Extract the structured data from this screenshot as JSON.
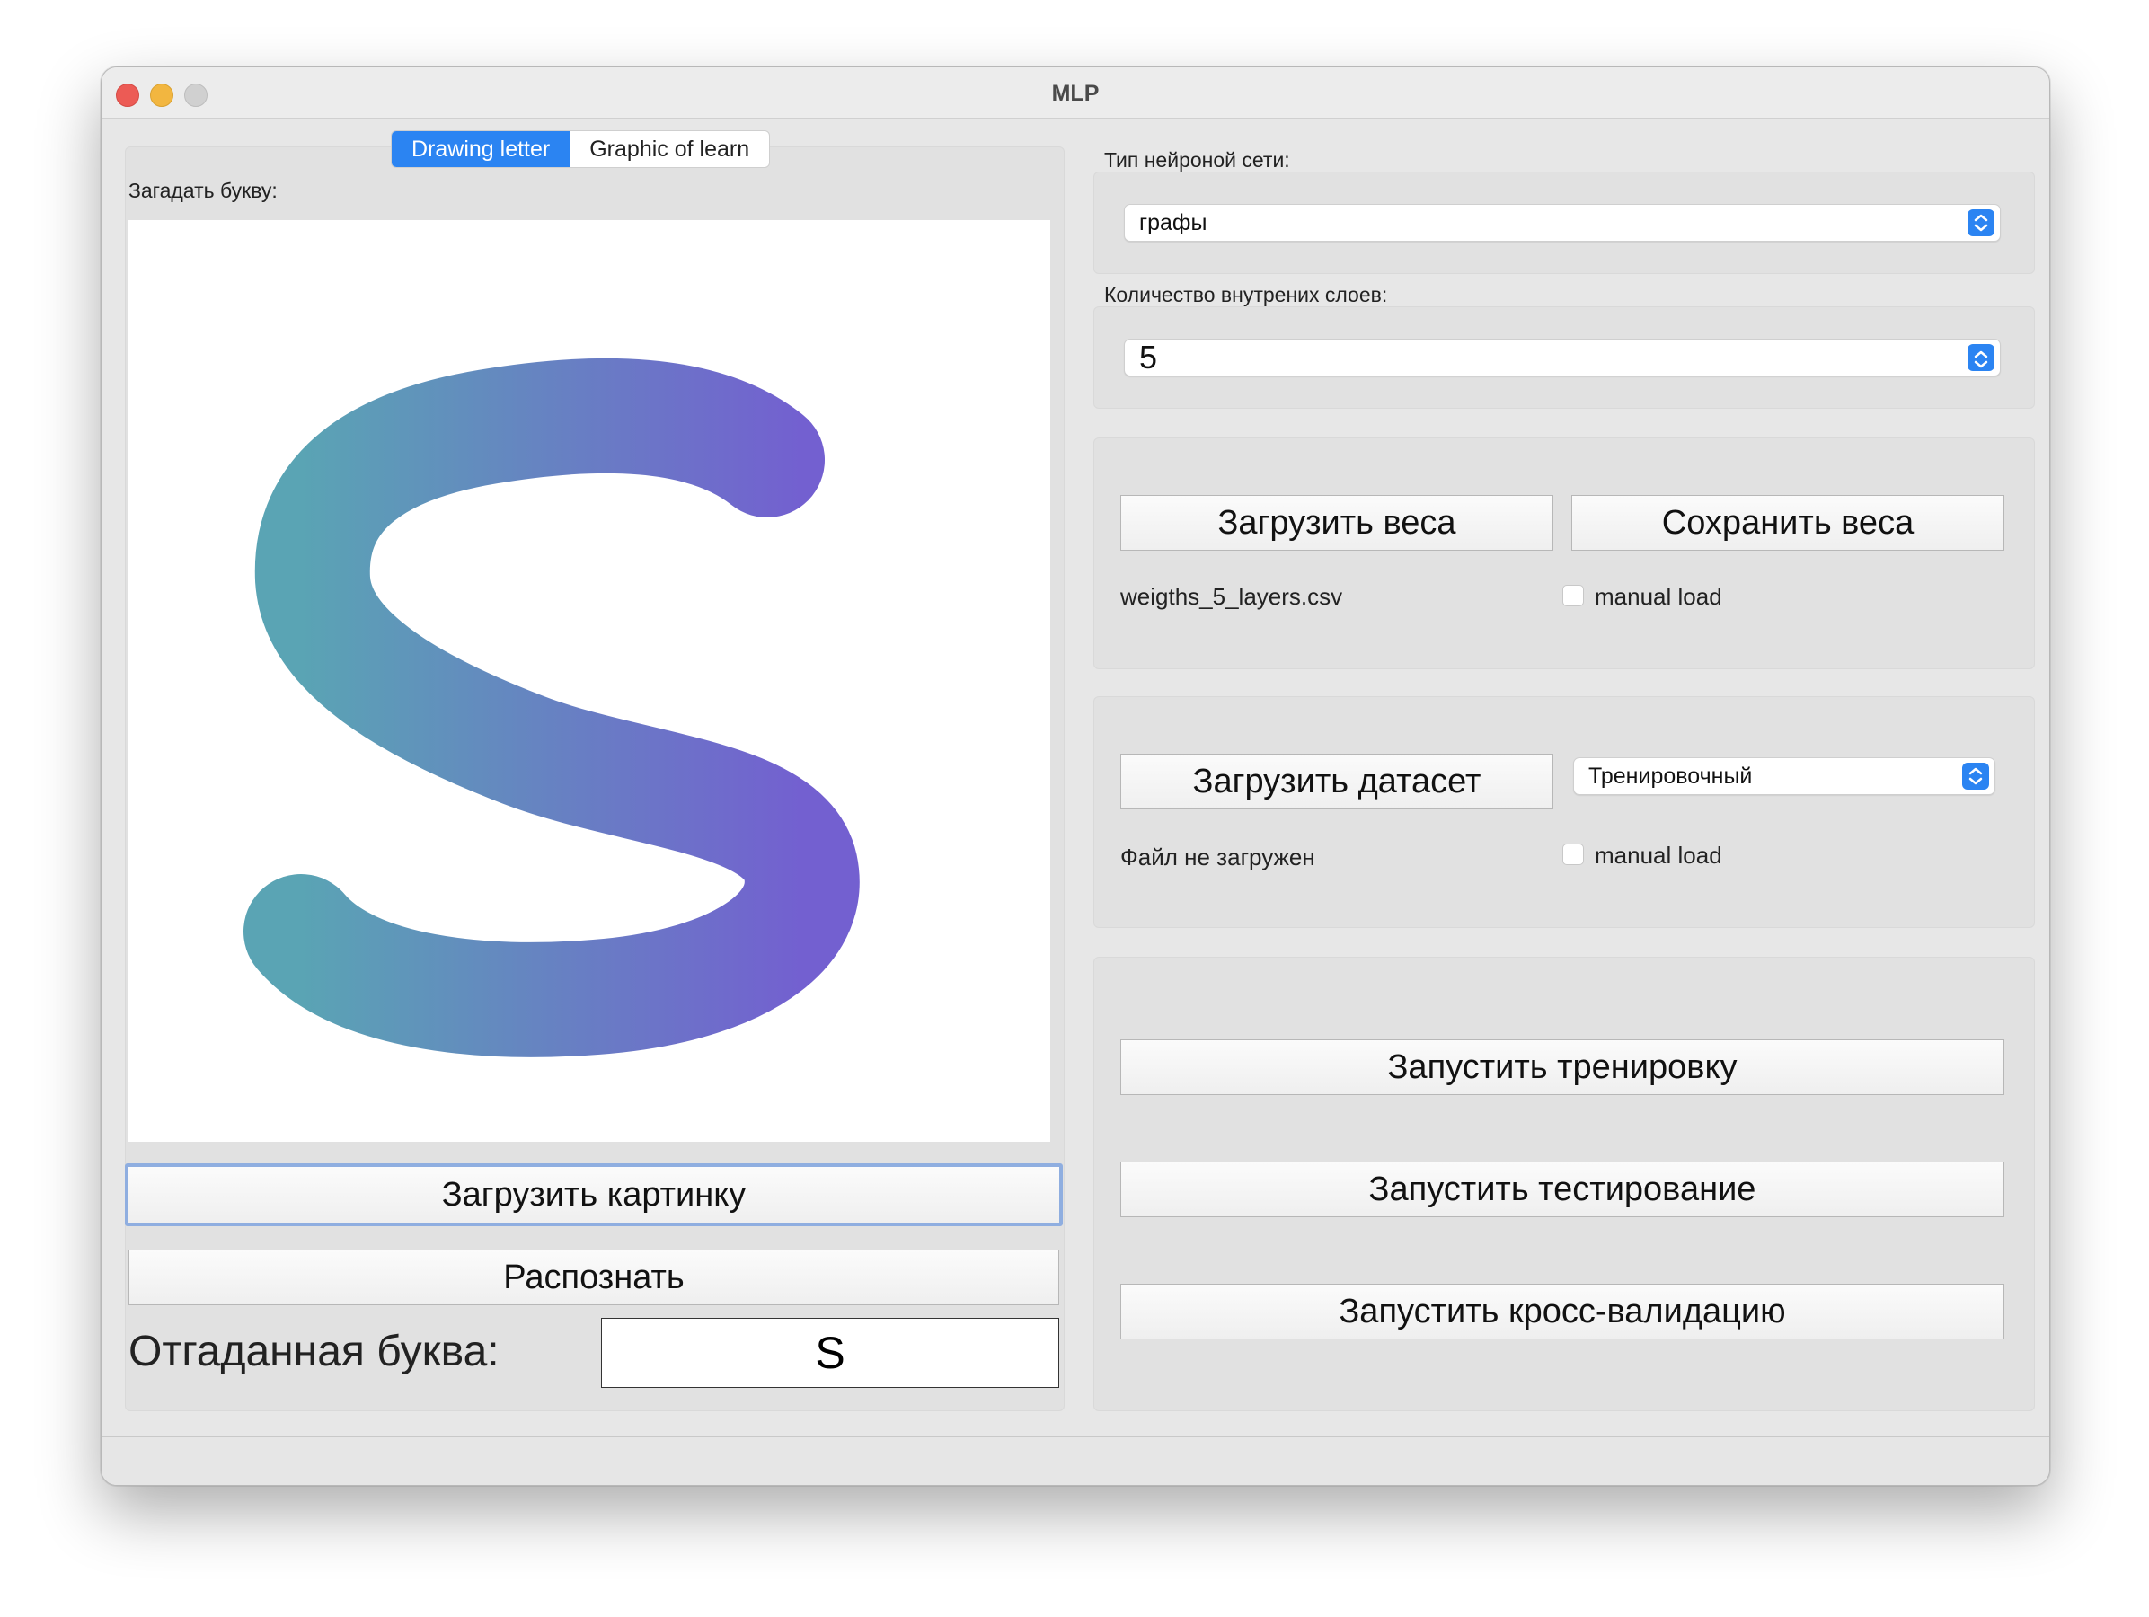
{
  "window": {
    "title": "MLP"
  },
  "tabs": [
    {
      "label": "Drawing letter",
      "active": true
    },
    {
      "label": "Graphic of learn",
      "active": false
    }
  ],
  "left": {
    "guess_label": "Загадать букву:",
    "load_image_button": "Загрузить картинку",
    "recognize_button": "Распознать",
    "guessed_label": "Отгаданная буква:",
    "guessed_value": "S"
  },
  "right": {
    "network_type_label": "Тип нейроной сети:",
    "network_type_value": "графы",
    "layers_label": "Количество внутрених слоев:",
    "layers_value": "5",
    "load_weights_button": "Загрузить веса",
    "save_weights_button": "Сохранить веса",
    "weights_file": "weigths_5_layers.csv",
    "manual_load_label_1": "manual load",
    "load_dataset_button": "Загрузить датасет",
    "dataset_type_value": "Тренировочный",
    "dataset_status": "Файл не загружен",
    "manual_load_label_2": "manual load",
    "start_training_button": "Запустить тренировку",
    "start_testing_button": "Запустить тестирование",
    "start_crossval_button": "Запустить кросс-валидацию"
  },
  "colors": {
    "accent": "#2b84f2",
    "stroke_start": "#5aa4b4",
    "stroke_end": "#7360d0"
  }
}
